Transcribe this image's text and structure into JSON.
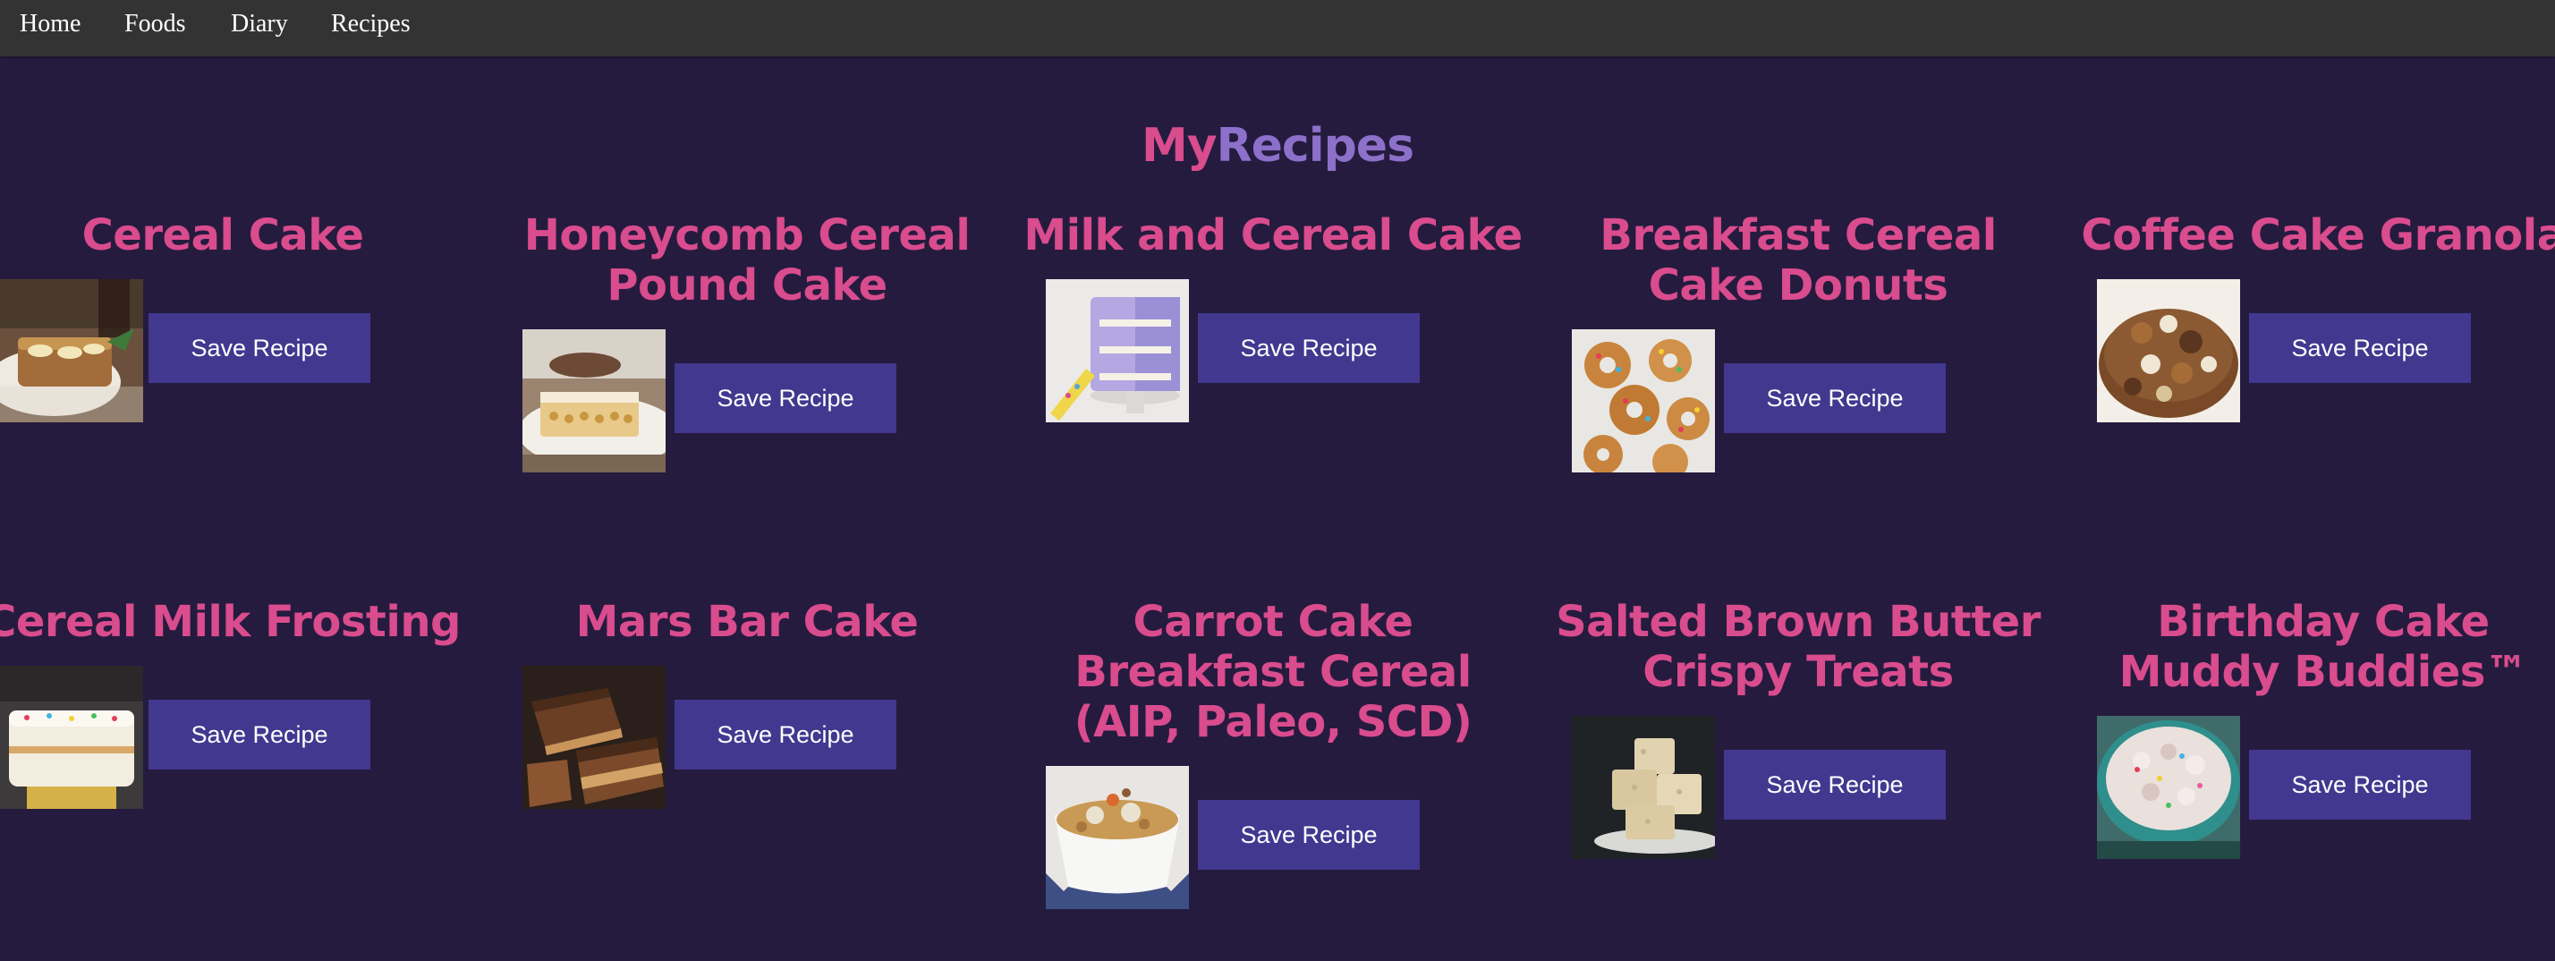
{
  "nav": {
    "items": [
      {
        "label": "Home"
      },
      {
        "label": "Foods"
      },
      {
        "label": "Diary"
      },
      {
        "label": "Recipes"
      }
    ]
  },
  "header": {
    "title_part1": "My",
    "title_part2": "Recipes"
  },
  "colors": {
    "page_background": "#251b3f",
    "navbar_background": "#333333",
    "nav_text": "#ffffff",
    "title_pink": "#d94c8d",
    "title_purple": "#8c70c9",
    "button_background": "#42388f",
    "button_text": "#ffffff"
  },
  "recipes": [
    {
      "title": "Cereal Cake",
      "button_label": "Save Recipe",
      "image_alt": "cereal-cake-photo"
    },
    {
      "title": "Honeycomb Cereal Pound Cake",
      "button_label": "Save Recipe",
      "image_alt": "honeycomb-pound-cake-photo"
    },
    {
      "title": "Milk and Cereal Cake",
      "button_label": "Save Recipe",
      "image_alt": "milk-cereal-cake-photo"
    },
    {
      "title": "Breakfast Cereal Cake Donuts",
      "button_label": "Save Recipe",
      "image_alt": "cereal-donuts-photo"
    },
    {
      "title": "Coffee Cake Granola",
      "button_label": "Save Recipe",
      "image_alt": "coffee-cake-granola-photo"
    },
    {
      "title": "Cereal Milk Frosting",
      "button_label": "Save Recipe",
      "image_alt": "cereal-milk-frosting-photo"
    },
    {
      "title": "Mars Bar Cake",
      "button_label": "Save Recipe",
      "image_alt": "mars-bar-cake-photo"
    },
    {
      "title": "Carrot Cake Breakfast Cereal (AIP, Paleo, SCD)",
      "button_label": "Save Recipe",
      "image_alt": "carrot-cake-cereal-photo"
    },
    {
      "title": "Salted Brown Butter Crispy Treats",
      "button_label": "Save Recipe",
      "image_alt": "crispy-treats-photo"
    },
    {
      "title": "Birthday Cake Muddy Buddies™",
      "button_label": "Save Recipe",
      "image_alt": "muddy-buddies-photo"
    }
  ]
}
